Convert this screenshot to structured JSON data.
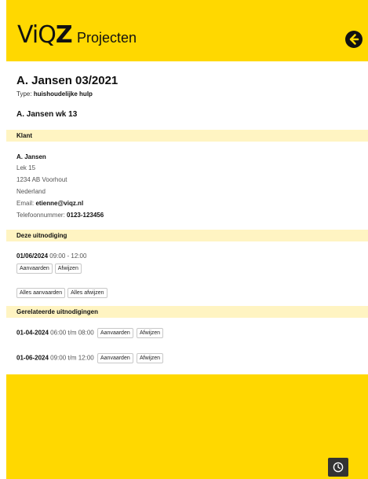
{
  "header": {
    "logo_text_vi": "Vi",
    "logo_text_q": "Q",
    "logo_text_z": "Z",
    "title": "Projecten",
    "back_icon": "arrow-left-circle-icon"
  },
  "project": {
    "title": "A. Jansen 03/2021",
    "type_label": "Type:",
    "type_value": "huishoudelijke hulp",
    "week_title": "A. Jansen wk 13"
  },
  "client": {
    "section_label": "Klant",
    "name": "A. Jansen",
    "street": "Lek 15",
    "postal_city": "1234 AB Voorhout",
    "country": "Nederland",
    "email_label": "Email:",
    "email_value": "etienne@viqz.nl",
    "phone_label": "Telefoonnummer:",
    "phone_value": "0123-123456"
  },
  "invitation": {
    "section_label": "Deze uitnodiging",
    "date": "01/06/2024",
    "time": "09:00 - 12:00",
    "accept_label": "Aanvaarden",
    "decline_label": "Afwijzen",
    "accept_all_label": "Alles aanvaarden",
    "decline_all_label": "Alles afwijzen"
  },
  "related": {
    "section_label": "Gerelateerde uitnodigingen",
    "items": [
      {
        "date": "01-04-2024",
        "time": "06:00 t/m 08:00",
        "accept_label": "Aanvaarden",
        "decline_label": "Afwijzen"
      },
      {
        "date": "01-06-2024",
        "time": "09:00 t/m 12:00",
        "accept_label": "Aanvaarden",
        "decline_label": "Afwijzen"
      }
    ]
  },
  "footer": {
    "clock_icon": "clock-icon"
  },
  "colors": {
    "brand_yellow": "#FFD800",
    "section_bar": "#FFF4C2",
    "dark": "#111111"
  }
}
